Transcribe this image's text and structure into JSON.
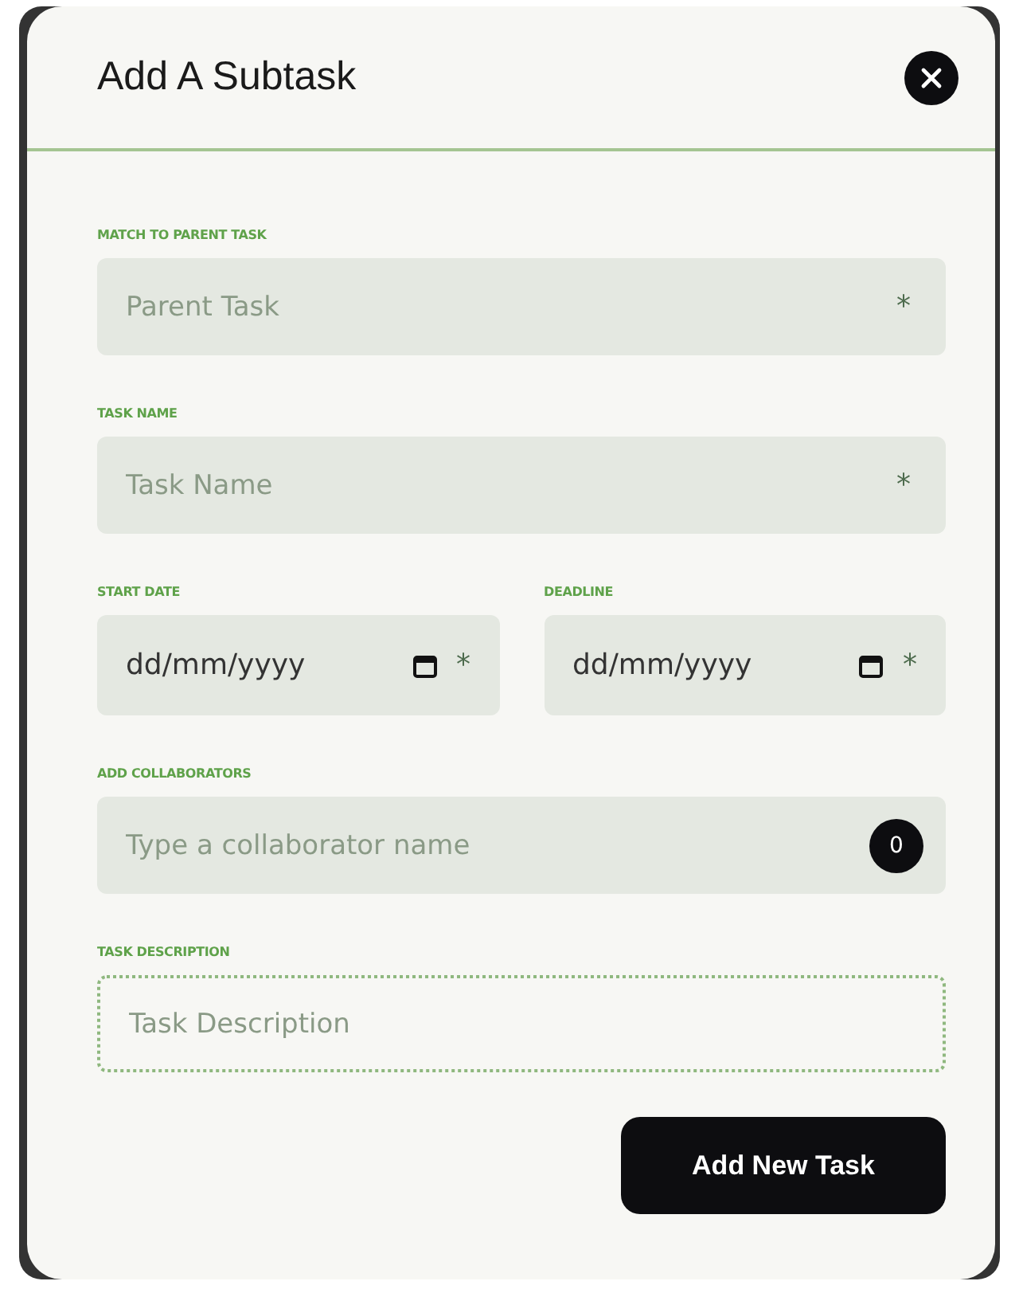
{
  "dialog": {
    "title": "Add A Subtask"
  },
  "fields": [
    {
      "kind": "text",
      "label": "MATCH TO PARENT TASK",
      "placeholder": "Parent Task",
      "required_mark": "*"
    },
    {
      "kind": "text",
      "label": "TASK NAME",
      "placeholder": "Task Name",
      "required_mark": "*"
    },
    {
      "kind": "date",
      "label": "START DATE",
      "value": "dd/mm/yyyy",
      "required_mark": "*"
    },
    {
      "kind": "date",
      "label": "DEADLINE",
      "value": "dd/mm/yyyy",
      "required_mark": "*"
    },
    {
      "kind": "collaborator",
      "label": "ADD COLLABORATORS",
      "placeholder": "Type a collaborator name",
      "count": "0"
    },
    {
      "kind": "textarea",
      "label": "TASK DESCRIPTION",
      "placeholder": "Task Description"
    }
  ],
  "submit_button": "Add New Task"
}
